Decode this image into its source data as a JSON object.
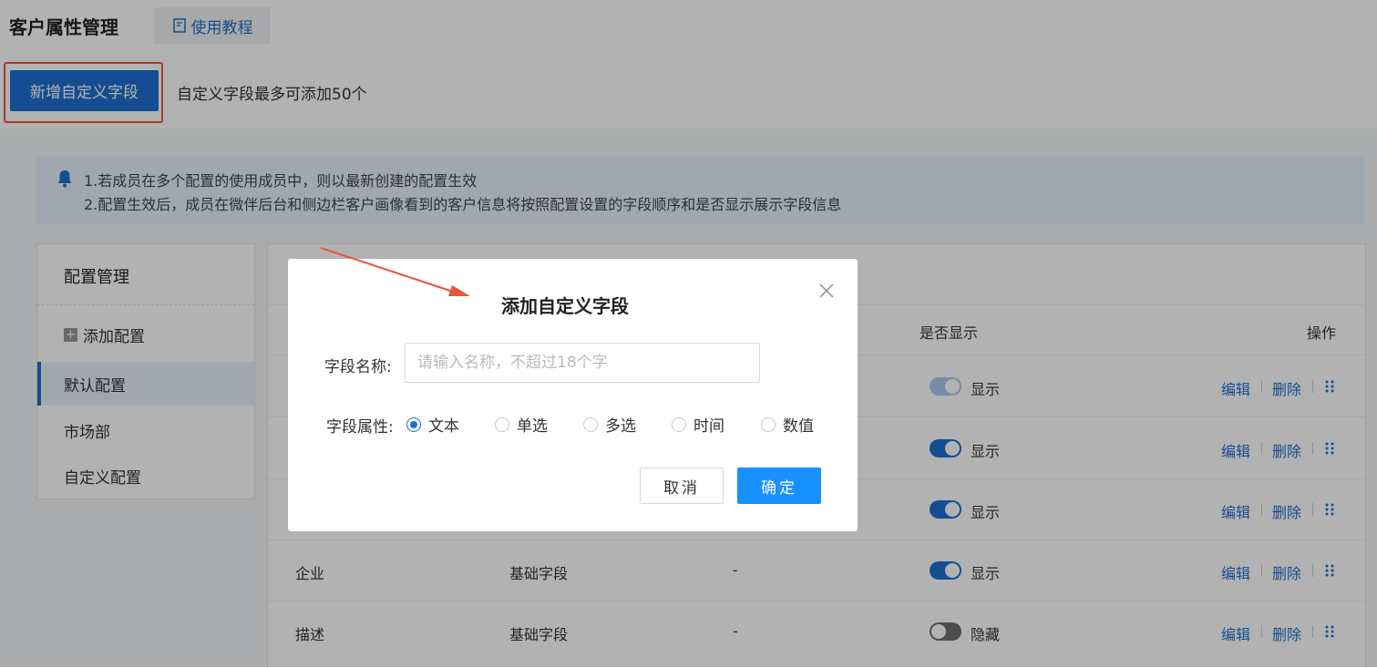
{
  "header": {
    "title": "客户属性管理",
    "tutorial_tab": "使用教程"
  },
  "toolbar": {
    "add_button": "新增自定义字段",
    "limit_text": "自定义字段最多可添加50个"
  },
  "notice": {
    "line1": "1.若成员在多个配置的使用成员中，则以最新创建的配置生效",
    "line2": "2.配置生效后，成员在微伴后台和侧边栏客户画像看到的客户信息将按照配置设置的字段顺序和是否显示展示字段信息"
  },
  "config": {
    "title": "配置管理",
    "add_label": "添加配置",
    "items": [
      {
        "label": "默认配置",
        "active": true
      },
      {
        "label": "市场部",
        "active": false
      },
      {
        "label": "自定义配置",
        "active": false
      }
    ]
  },
  "table": {
    "headers": {
      "display": "是否显示",
      "actions": "操作"
    },
    "rows": [
      {
        "name": "",
        "type": "",
        "extra": "",
        "display_label": "显示",
        "state": "disabled"
      },
      {
        "name": "",
        "type": "",
        "extra": "",
        "display_label": "显示",
        "state": "on"
      },
      {
        "name": "",
        "type": "",
        "extra": "",
        "display_label": "显示",
        "state": "on"
      },
      {
        "name": "企业",
        "type": "基础字段",
        "extra": "-",
        "display_label": "显示",
        "state": "on"
      },
      {
        "name": "描述",
        "type": "基础字段",
        "extra": "-",
        "display_label": "隐藏",
        "state": "off"
      }
    ],
    "edit_label": "编辑",
    "delete_label": "删除"
  },
  "modal": {
    "title": "添加自定义字段",
    "name_label": "字段名称:",
    "name_placeholder": "请输入名称，不超过18个字",
    "name_value": "",
    "attr_label": "字段属性:",
    "options": [
      "文本",
      "单选",
      "多选",
      "时间",
      "数值"
    ],
    "selected_option": "文本",
    "cancel_label": "取消",
    "ok_label": "确定"
  },
  "colors": {
    "primary": "#1e6fd0",
    "highlight": "#e8553d",
    "ok_button": "#1890ff"
  }
}
